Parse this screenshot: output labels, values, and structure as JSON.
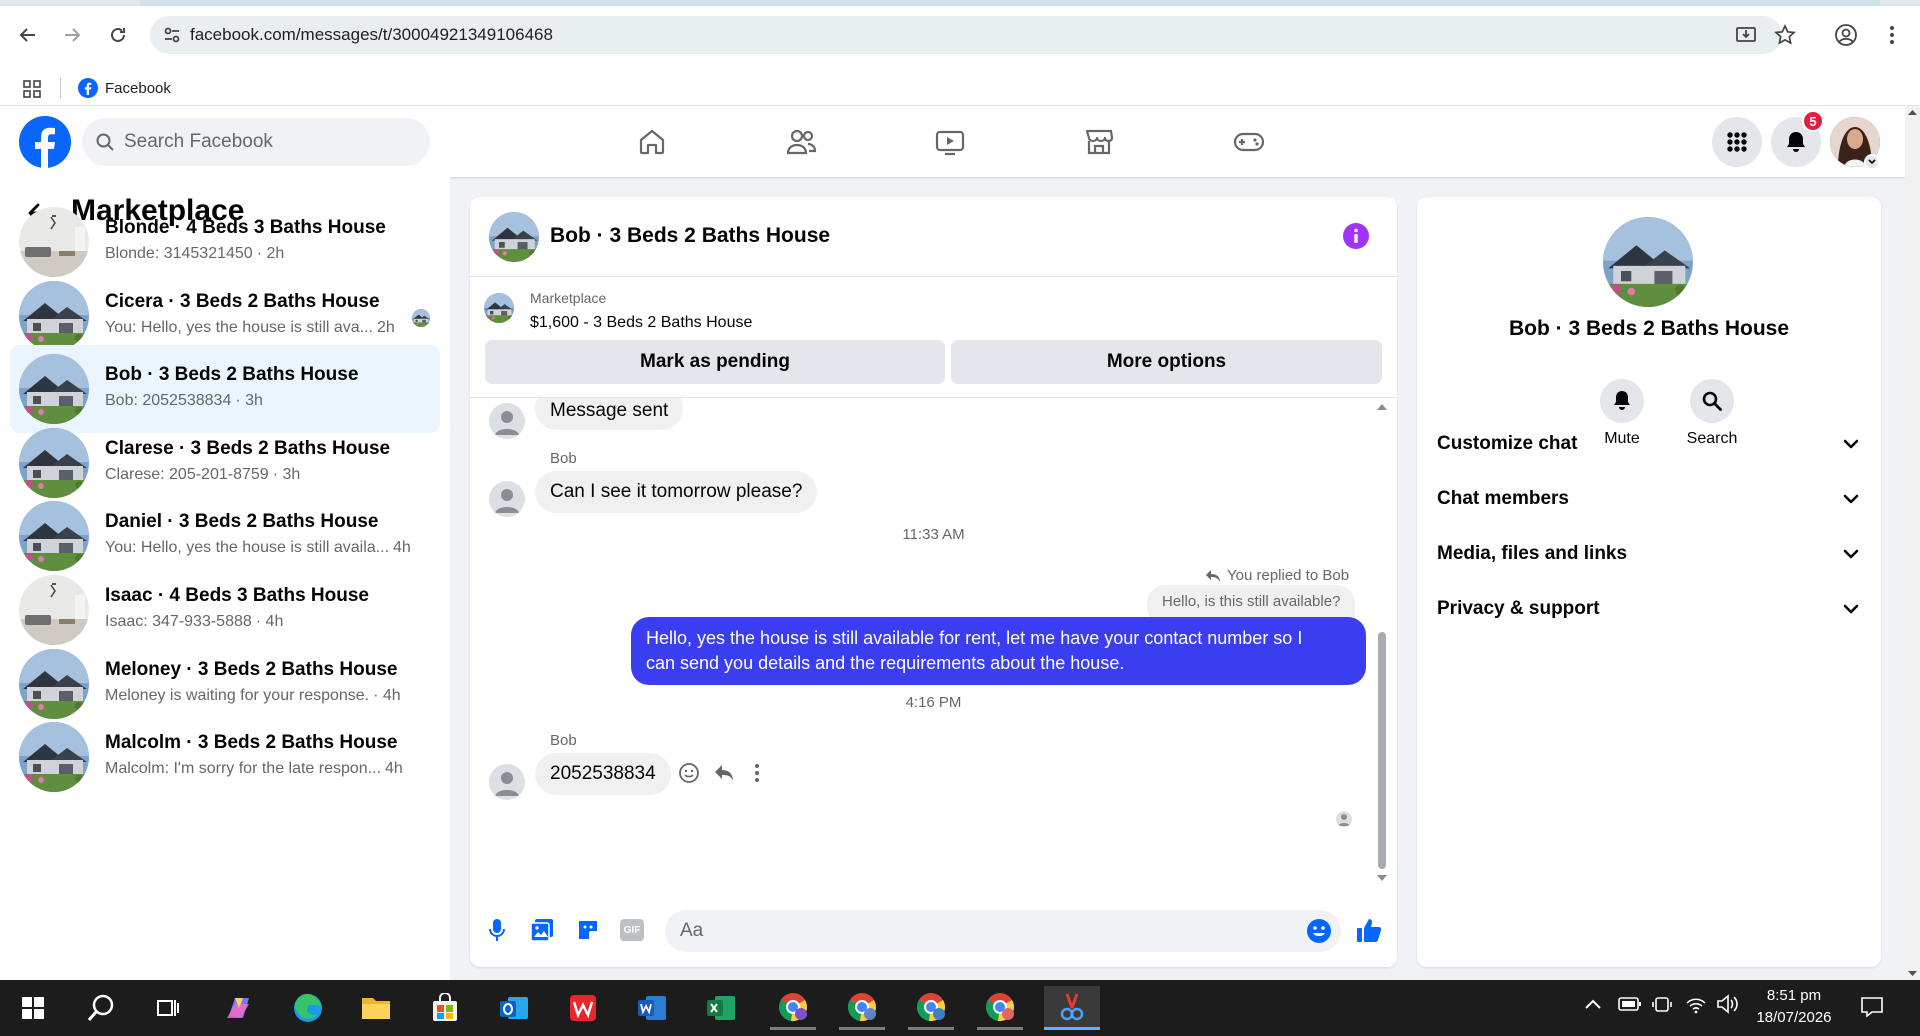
{
  "browser": {
    "url": "facebook.com/messages/t/30004921349106468",
    "bookmark_label": "Facebook"
  },
  "header": {
    "search_placeholder": "Search Facebook",
    "notification_count": "5"
  },
  "sidebar": {
    "title": "Marketplace",
    "conversations": [
      {
        "title": "Blonde · 4 Beds 3 Baths House",
        "sub": "Blonde: 3145321450",
        "time": "· 2h",
        "thumb": "interior"
      },
      {
        "title": "Cicera · 3 Beds 2 Baths House",
        "sub": "You: Hello, yes the house is still ava...",
        "time": "2h",
        "thumb": "house"
      },
      {
        "title": "Bob · 3 Beds 2 Baths House",
        "sub": "Bob: 2052538834",
        "time": "· 3h",
        "thumb": "house"
      },
      {
        "title": "Clarese · 3 Beds 2 Baths House",
        "sub": "Clarese: 205-201-8759",
        "time": "· 3h",
        "thumb": "house"
      },
      {
        "title": "Daniel · 3 Beds 2 Baths House",
        "sub": "You: Hello, yes the house is still availa...",
        "time": "4h",
        "thumb": "house"
      },
      {
        "title": "Isaac · 4 Beds 3 Baths House",
        "sub": "Isaac: 347-933-5888",
        "time": "· 4h",
        "thumb": "interior"
      },
      {
        "title": "Meloney · 3 Beds 2 Baths House",
        "sub": "Meloney is waiting for your response.",
        "time": "· 4h",
        "thumb": "house"
      },
      {
        "title": "Malcolm · 3 Beds 2 Baths House",
        "sub": "Malcolm: I'm sorry for the late respon...",
        "time": "4h",
        "thumb": "house"
      }
    ]
  },
  "chat": {
    "title": "Bob · 3 Beds 2 Baths House",
    "listing_source": "Marketplace",
    "listing_price": "$1,600 - 3 Beds 2 Baths House",
    "mark_pending_label": "Mark as pending",
    "more_options_label": "More options",
    "messages": {
      "partial_bubble": "Message sent",
      "sender1": "Bob",
      "bubble1": "Can I see it tomorrow please?",
      "time1": "11:33 AM",
      "replied_label": "You replied to Bob",
      "quoted": "Hello, is this still available?",
      "my_line1": "Hello, yes the house is still available for rent, let me have your contact number so I",
      "my_line2": "can send you details and the requirements about the house.",
      "time2": "4:16 PM",
      "sender2": "Bob",
      "bubble2": "2052538834"
    },
    "composer_placeholder": "Aa",
    "gif_label": "GIF"
  },
  "info": {
    "title": "Bob · 3 Beds 2 Baths House",
    "mute_label": "Mute",
    "search_label": "Search",
    "sections": [
      "Customize chat",
      "Chat members",
      "Media, files and links",
      "Privacy & support"
    ]
  },
  "taskbar": {
    "time": "8:51 pm",
    "date": "18/07/2026"
  },
  "colors": {
    "fb_blue": "#0866ff",
    "messenger_bubble": "#3b3ef0",
    "info_purple": "#a033ff",
    "notification_red": "#e41e3f"
  }
}
